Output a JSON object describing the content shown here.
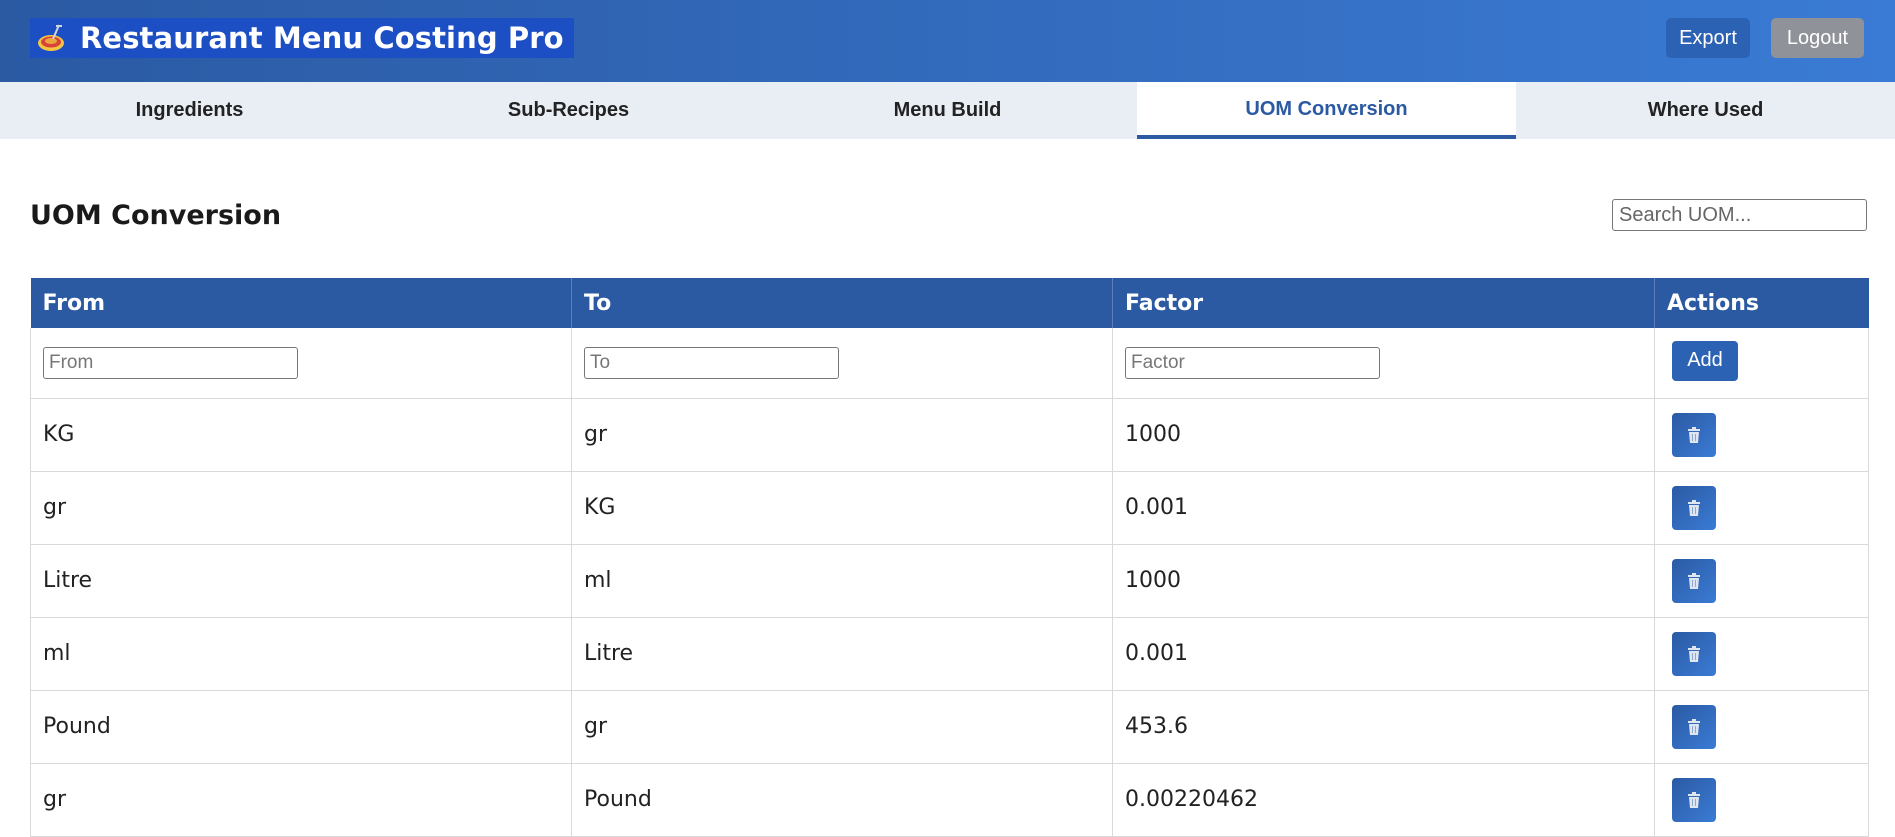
{
  "app": {
    "title": "Restaurant Menu Costing Pro",
    "logo_icon": "spaghetti-bowl-icon"
  },
  "header": {
    "export_label": "Export",
    "logout_label": "Logout"
  },
  "tabs": [
    {
      "label": "Ingredients",
      "active": false
    },
    {
      "label": "Sub-Recipes",
      "active": false
    },
    {
      "label": "Menu Build",
      "active": false
    },
    {
      "label": "UOM Conversion",
      "active": true
    },
    {
      "label": "Where Used",
      "active": false
    }
  ],
  "page": {
    "title": "UOM Conversion",
    "search_placeholder": "Search UOM..."
  },
  "table": {
    "headers": [
      "From",
      "To",
      "Factor",
      "Actions"
    ],
    "new_row": {
      "from_placeholder": "From",
      "to_placeholder": "To",
      "factor_placeholder": "Factor",
      "add_label": "Add"
    },
    "rows": [
      {
        "from": "KG",
        "to": "gr",
        "factor": "1000"
      },
      {
        "from": "gr",
        "to": "KG",
        "factor": "0.001"
      },
      {
        "from": "Litre",
        "to": "ml",
        "factor": "1000"
      },
      {
        "from": "ml",
        "to": "Litre",
        "factor": "0.001"
      },
      {
        "from": "Pound",
        "to": "gr",
        "factor": "453.6"
      },
      {
        "from": "gr",
        "to": "Pound",
        "factor": "0.00220462"
      }
    ],
    "delete_icon": "trash-icon"
  },
  "colors": {
    "primary": "#2b5aa3",
    "header_gradient_end": "#3a7bd5",
    "logout_gray": "#8f9299",
    "tabs_bg": "#e9eef5"
  }
}
